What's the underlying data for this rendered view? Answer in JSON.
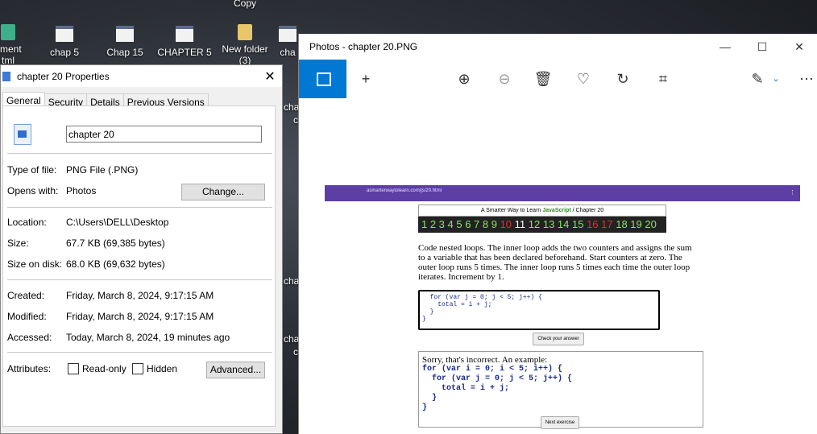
{
  "desktop": {
    "copy_label": "Copy",
    "icons": [
      {
        "label": "nment\ntml"
      },
      {
        "label": "chap 5"
      },
      {
        "label": "Chap 15"
      },
      {
        "label": "CHAPTER 5"
      },
      {
        "label": "New folder\n(3)"
      },
      {
        "label": "cha"
      }
    ]
  },
  "properties": {
    "title": "chapter 20 Properties",
    "tabs": [
      "General",
      "Security",
      "Details",
      "Previous Versions"
    ],
    "file_name": "chapter 20",
    "type_label": "Type of file:",
    "type_value": "PNG File (.PNG)",
    "opens_label": "Opens with:",
    "opens_value": "Photos",
    "change_button": "Change...",
    "location_label": "Location:",
    "location_value": "C:\\Users\\DELL\\Desktop",
    "size_label": "Size:",
    "size_value": "67.7 KB (69,385 bytes)",
    "size_disk_label": "Size on disk:",
    "size_disk_value": "68.0 KB (69,632 bytes)",
    "created_label": "Created:",
    "created_value": "Friday, March 8, 2024, 9:17:15 AM",
    "modified_label": "Modified:",
    "modified_value": "Friday, March 8, 2024, 9:17:15 AM",
    "accessed_label": "Accessed:",
    "accessed_value": "Today, March 8, 2024, 19 minutes ago",
    "attributes_label": "Attributes:",
    "readonly_label": "Read-only",
    "hidden_label": "Hidden",
    "advanced_button": "Advanced..."
  },
  "photos": {
    "title": "Photos - chapter 20.PNG",
    "screenshot": {
      "url": "asmarterwaytolearn.com/js/20.html",
      "book_title_prefix": "A Smarter Way to Learn ",
      "book_title_js": "JavaScript",
      "book_title_suffix": " / Chapter 20",
      "numbers_green_a": "1 2 3 4 5 6 7 8 9 ",
      "numbers_red_a": "10 ",
      "numbers_white": "11 ",
      "numbers_green_b": "12 13 14 15 ",
      "numbers_red_b": "16 17 ",
      "numbers_green_c": "18 19 20",
      "task": "Code nested loops. The inner loop adds the two counters and assigns the sum to a variable that has been declared beforehand. Start counters at zero. The outer loop runs 5 times. The inner loop runs 5 times each time the outer loop iterates. Increment by 1.",
      "user_code": "  for (var j = 0; j < 5; j++) {\n    total = i + j;\n  }\n}",
      "check_button": "Check your answer",
      "feedback": "Sorry, that's incorrect. An example:",
      "example_code": "for (var i = 0; i < 5; i++) {\n  for (var j = 0; j < 5; j++) {\n    total = i + j;\n  }\n}",
      "next_button": "Next exercise"
    }
  },
  "side_labels": [
    "cha",
    "c",
    "chap",
    "cha",
    "c"
  ]
}
